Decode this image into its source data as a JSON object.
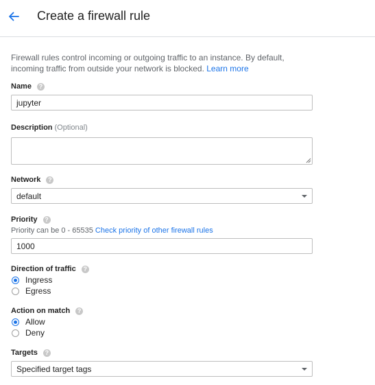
{
  "header": {
    "back_icon": "arrow-left-icon",
    "title": "Create a firewall rule"
  },
  "intro": {
    "text": "Firewall rules control incoming or outgoing traffic to an instance. By default, incoming traffic from outside your network is blocked.",
    "learn_more": "Learn more"
  },
  "name": {
    "label": "Name",
    "value": "jupyter"
  },
  "description": {
    "label": "Description",
    "optional": "(Optional)",
    "value": ""
  },
  "network": {
    "label": "Network",
    "selected": "default"
  },
  "priority": {
    "label": "Priority",
    "hint": "Priority can be 0 - 65535",
    "hint_link": "Check priority of other firewall rules",
    "value": "1000"
  },
  "direction": {
    "label": "Direction of traffic",
    "options": [
      {
        "label": "Ingress",
        "checked": true
      },
      {
        "label": "Egress",
        "checked": false
      }
    ]
  },
  "action": {
    "label": "Action on match",
    "options": [
      {
        "label": "Allow",
        "checked": true
      },
      {
        "label": "Deny",
        "checked": false
      }
    ]
  },
  "targets": {
    "label": "Targets",
    "selected": "Specified target tags"
  },
  "colors": {
    "accent": "#1a73e8",
    "help_icon": "#c8c8c8",
    "border": "#bdbdbd"
  }
}
